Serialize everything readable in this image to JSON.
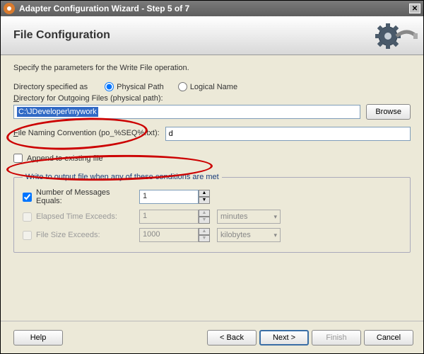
{
  "window": {
    "title": "Adapter Configuration Wizard - Step 5 of 7"
  },
  "header": {
    "title": "File Configuration"
  },
  "instruction": "Specify the parameters for the Write File operation.",
  "dirSpec": {
    "label": "Directory specified as",
    "physical": "Physical Path",
    "logical": "Logical Name",
    "selected": "physical"
  },
  "outgoing": {
    "label_pre": "D",
    "label_rest": "irectory for Outgoing Files (physical path):",
    "value": "C:\\JDeveloper\\mywork",
    "browse": "Browse"
  },
  "naming": {
    "label_pre": "F",
    "label_rest": "ile Naming Convention (po_%SEQ%.txt):",
    "value": "d"
  },
  "append": {
    "label_pre": "A",
    "label_rest": "ppend to existing file",
    "checked": false
  },
  "conditions": {
    "legend": "Write to output file when any of these conditions are met",
    "numMessages": {
      "label_pre": "N",
      "label_rest": "umber of Messages Equals:",
      "value": "1",
      "checked": true,
      "enabled": true
    },
    "elapsed": {
      "label_pre": "E",
      "label_rest": "lapsed Time Exceeds:",
      "value": "1",
      "checked": false,
      "enabled": false,
      "unit": "minutes"
    },
    "fileSize": {
      "label_pre": "F",
      "label_rest": "ile Size Exceeds:",
      "value": "1000",
      "checked": false,
      "enabled": false,
      "unit": "kilobytes"
    }
  },
  "footer": {
    "help": "Help",
    "back": "< Back",
    "next": "Next >",
    "finish": "Finish",
    "cancel": "Cancel"
  }
}
